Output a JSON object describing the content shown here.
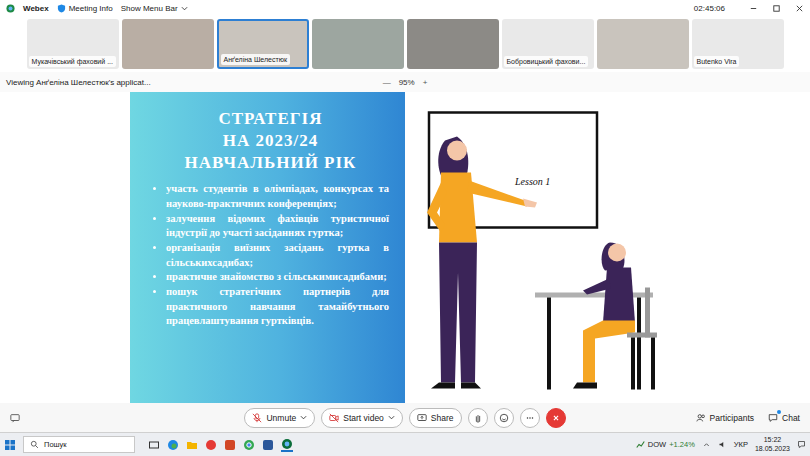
{
  "window": {
    "title": "Webex",
    "meeting_info": "Meeting Info",
    "menu_toggle": "Show Menu Bar",
    "timer": "02:45:06"
  },
  "participants": [
    {
      "name": "Мукачівський фаховий ...",
      "kind": "name",
      "selected": false
    },
    {
      "kind": "video",
      "selected": false
    },
    {
      "name": "Анґеліна Шелестюк",
      "kind": "video",
      "selected": true
    },
    {
      "kind": "video",
      "selected": false
    },
    {
      "kind": "video",
      "selected": false
    },
    {
      "name": "Бобровицький фахови...",
      "kind": "name",
      "selected": false
    },
    {
      "kind": "video",
      "selected": false
    },
    {
      "name": "Butenko Vira",
      "kind": "name",
      "selected": false
    }
  ],
  "viewing": {
    "label": "Viewing Анґеліна Шелестюк's applicat...",
    "zoom_out": "—",
    "zoom": "95%",
    "zoom_in": "+"
  },
  "slide": {
    "title": [
      "СТРАТЕГІЯ",
      "НА 2023/24",
      "НАВЧАЛЬНИЙ РІК"
    ],
    "bullets": [
      "участь студентів в олімпіадах, конкурсах та науково-практичних конференціях;",
      "залучення відомих фахівців туристичної індустрії до участі засіданнях гуртка;",
      "організація виїзних засідань гуртка в сільськихсадибах;",
      "практичне знайомство з сільськимисадибами;",
      "пошук стратегічних партнерів для практичного навчання тамайбутнього працевлаштування гуртківців."
    ],
    "board_text": "Lesson 1"
  },
  "controls": {
    "unmute": "Unmute",
    "start_video": "Start video",
    "share": "Share",
    "participants": "Participants",
    "chat": "Chat",
    "chat_unread": true
  },
  "taskbar": {
    "search": "Пошук",
    "ticker": "DOW",
    "change": "+1.24%",
    "language": "УКР",
    "time": "15:22",
    "date": "18.05.2023"
  }
}
